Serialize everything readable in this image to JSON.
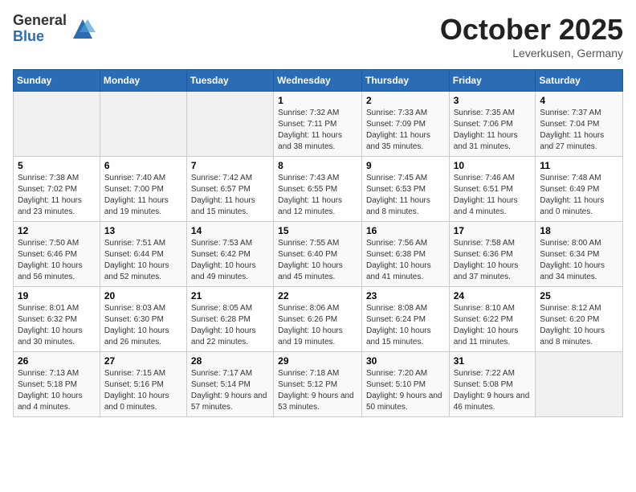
{
  "logo": {
    "general": "General",
    "blue": "Blue"
  },
  "title": "October 2025",
  "subtitle": "Leverkusen, Germany",
  "days_of_week": [
    "Sunday",
    "Monday",
    "Tuesday",
    "Wednesday",
    "Thursday",
    "Friday",
    "Saturday"
  ],
  "weeks": [
    [
      {
        "day": "",
        "info": ""
      },
      {
        "day": "",
        "info": ""
      },
      {
        "day": "",
        "info": ""
      },
      {
        "day": "1",
        "info": "Sunrise: 7:32 AM\nSunset: 7:11 PM\nDaylight: 11 hours and 38 minutes."
      },
      {
        "day": "2",
        "info": "Sunrise: 7:33 AM\nSunset: 7:09 PM\nDaylight: 11 hours and 35 minutes."
      },
      {
        "day": "3",
        "info": "Sunrise: 7:35 AM\nSunset: 7:06 PM\nDaylight: 11 hours and 31 minutes."
      },
      {
        "day": "4",
        "info": "Sunrise: 7:37 AM\nSunset: 7:04 PM\nDaylight: 11 hours and 27 minutes."
      }
    ],
    [
      {
        "day": "5",
        "info": "Sunrise: 7:38 AM\nSunset: 7:02 PM\nDaylight: 11 hours and 23 minutes."
      },
      {
        "day": "6",
        "info": "Sunrise: 7:40 AM\nSunset: 7:00 PM\nDaylight: 11 hours and 19 minutes."
      },
      {
        "day": "7",
        "info": "Sunrise: 7:42 AM\nSunset: 6:57 PM\nDaylight: 11 hours and 15 minutes."
      },
      {
        "day": "8",
        "info": "Sunrise: 7:43 AM\nSunset: 6:55 PM\nDaylight: 11 hours and 12 minutes."
      },
      {
        "day": "9",
        "info": "Sunrise: 7:45 AM\nSunset: 6:53 PM\nDaylight: 11 hours and 8 minutes."
      },
      {
        "day": "10",
        "info": "Sunrise: 7:46 AM\nSunset: 6:51 PM\nDaylight: 11 hours and 4 minutes."
      },
      {
        "day": "11",
        "info": "Sunrise: 7:48 AM\nSunset: 6:49 PM\nDaylight: 11 hours and 0 minutes."
      }
    ],
    [
      {
        "day": "12",
        "info": "Sunrise: 7:50 AM\nSunset: 6:46 PM\nDaylight: 10 hours and 56 minutes."
      },
      {
        "day": "13",
        "info": "Sunrise: 7:51 AM\nSunset: 6:44 PM\nDaylight: 10 hours and 52 minutes."
      },
      {
        "day": "14",
        "info": "Sunrise: 7:53 AM\nSunset: 6:42 PM\nDaylight: 10 hours and 49 minutes."
      },
      {
        "day": "15",
        "info": "Sunrise: 7:55 AM\nSunset: 6:40 PM\nDaylight: 10 hours and 45 minutes."
      },
      {
        "day": "16",
        "info": "Sunrise: 7:56 AM\nSunset: 6:38 PM\nDaylight: 10 hours and 41 minutes."
      },
      {
        "day": "17",
        "info": "Sunrise: 7:58 AM\nSunset: 6:36 PM\nDaylight: 10 hours and 37 minutes."
      },
      {
        "day": "18",
        "info": "Sunrise: 8:00 AM\nSunset: 6:34 PM\nDaylight: 10 hours and 34 minutes."
      }
    ],
    [
      {
        "day": "19",
        "info": "Sunrise: 8:01 AM\nSunset: 6:32 PM\nDaylight: 10 hours and 30 minutes."
      },
      {
        "day": "20",
        "info": "Sunrise: 8:03 AM\nSunset: 6:30 PM\nDaylight: 10 hours and 26 minutes."
      },
      {
        "day": "21",
        "info": "Sunrise: 8:05 AM\nSunset: 6:28 PM\nDaylight: 10 hours and 22 minutes."
      },
      {
        "day": "22",
        "info": "Sunrise: 8:06 AM\nSunset: 6:26 PM\nDaylight: 10 hours and 19 minutes."
      },
      {
        "day": "23",
        "info": "Sunrise: 8:08 AM\nSunset: 6:24 PM\nDaylight: 10 hours and 15 minutes."
      },
      {
        "day": "24",
        "info": "Sunrise: 8:10 AM\nSunset: 6:22 PM\nDaylight: 10 hours and 11 minutes."
      },
      {
        "day": "25",
        "info": "Sunrise: 8:12 AM\nSunset: 6:20 PM\nDaylight: 10 hours and 8 minutes."
      }
    ],
    [
      {
        "day": "26",
        "info": "Sunrise: 7:13 AM\nSunset: 5:18 PM\nDaylight: 10 hours and 4 minutes."
      },
      {
        "day": "27",
        "info": "Sunrise: 7:15 AM\nSunset: 5:16 PM\nDaylight: 10 hours and 0 minutes."
      },
      {
        "day": "28",
        "info": "Sunrise: 7:17 AM\nSunset: 5:14 PM\nDaylight: 9 hours and 57 minutes."
      },
      {
        "day": "29",
        "info": "Sunrise: 7:18 AM\nSunset: 5:12 PM\nDaylight: 9 hours and 53 minutes."
      },
      {
        "day": "30",
        "info": "Sunrise: 7:20 AM\nSunset: 5:10 PM\nDaylight: 9 hours and 50 minutes."
      },
      {
        "day": "31",
        "info": "Sunrise: 7:22 AM\nSunset: 5:08 PM\nDaylight: 9 hours and 46 minutes."
      },
      {
        "day": "",
        "info": ""
      }
    ]
  ]
}
